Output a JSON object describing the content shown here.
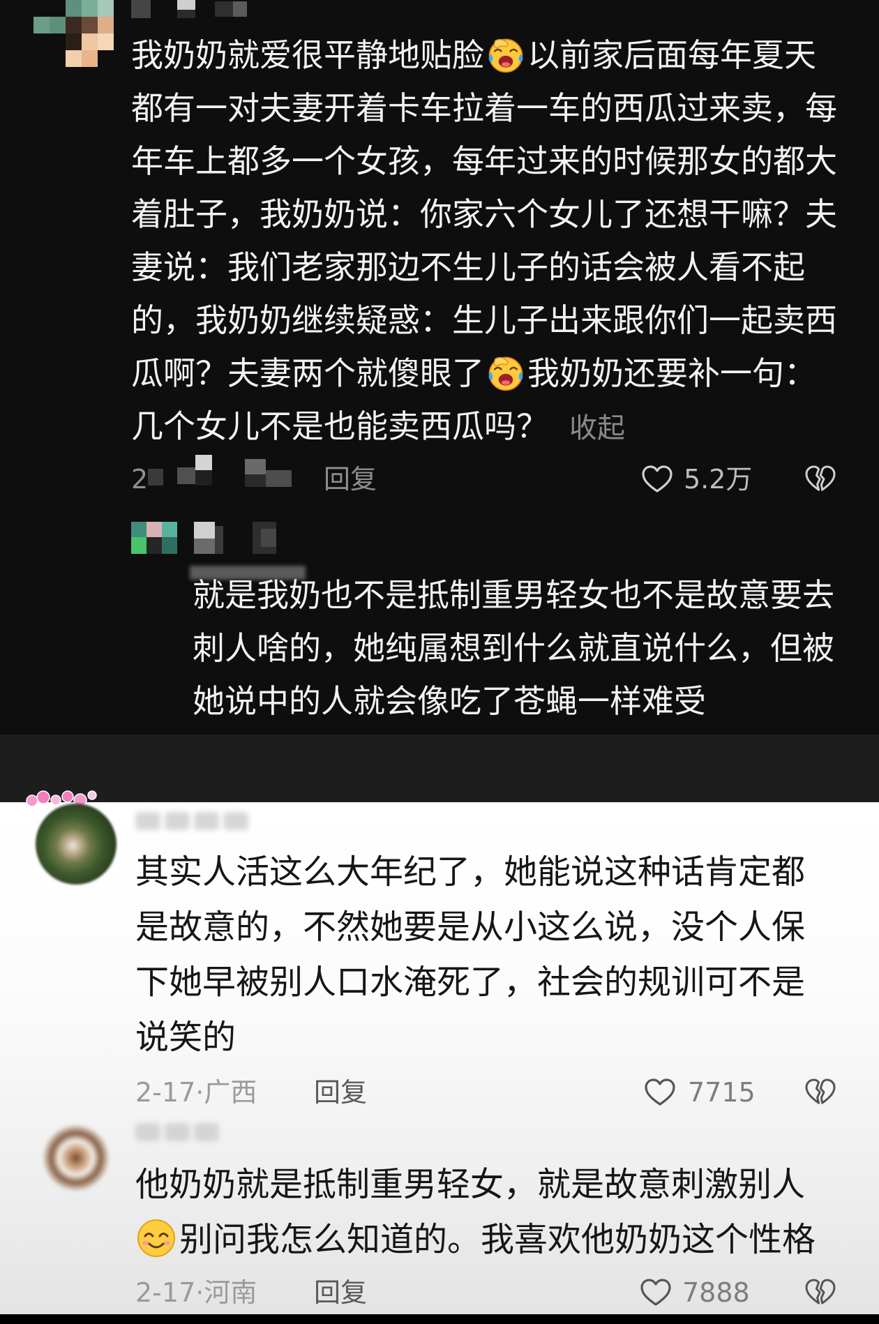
{
  "theme": {
    "dark_bg": "#0e0e0e",
    "dark_band": "#1d1d1d",
    "dark_text": "#f2f2f2",
    "light_text": "#161616",
    "meta_gray_dark": "#8f8f8f",
    "meta_gray_light": "#9a9a9a",
    "like_count_dark": "#bdbdbd"
  },
  "top_comment": {
    "avatar": "pixelated-avatar",
    "lines": [
      [
        "我奶奶就爱很平静地贴脸",
        {
          "emoji": "facepalm-laugh-emoji"
        },
        "以前家后面每年夏天"
      ],
      [
        "都有一对夫妻开着卡车拉着一车的西瓜过来卖，每"
      ],
      [
        "年车上都多一个女孩，每年过来的时候那女的都大"
      ],
      [
        "着肚子，我奶奶说：你家六个女儿了还想干嘛？夫"
      ],
      [
        "妻说：我们老家那边不生儿子的话会被人看不起"
      ],
      [
        "的，我奶奶继续疑惑：生儿子出来跟你们一起卖西"
      ],
      [
        "瓜啊？夫妻两个就傻眼了",
        {
          "emoji": "facepalm-laugh-emoji"
        },
        "我奶奶还要补一句："
      ],
      [
        "几个女儿不是也能卖西瓜吗？"
      ]
    ],
    "collapse_label": "收起",
    "time": "2",
    "reply_label": "回复",
    "like_icon": "heart-outline-icon",
    "like_count": "5.2万",
    "dislike_icon": "broken-heart-icon",
    "reply": {
      "avatar": "pixelated-avatar",
      "lines": [
        [
          "就是我奶也不是抵制重男轻女也不是故意要去"
        ],
        [
          "刺人啥的，她纯属想到什么就直说什么，但被"
        ],
        [
          "她说中的人就会像吃了苍蝇一样难受"
        ]
      ]
    }
  },
  "comments": [
    {
      "avatar": "blurred-avatar",
      "lines": [
        [
          "其实人活这么大年纪了，她能说这种话肯定都"
        ],
        [
          "是故意的，不然她要是从小这么说，没个人保"
        ],
        [
          "下她早被别人口水淹死了，社会的规训可不是"
        ],
        [
          "说笑的"
        ]
      ],
      "time_location": "2-17·广西",
      "reply_label": "回复",
      "like_icon": "heart-outline-icon",
      "like_count": "7715",
      "dislike_icon": "broken-heart-icon"
    },
    {
      "avatar": "blurred-avatar",
      "lines": [
        [
          "他奶奶就是抵制重男轻女，就是故意刺激别人"
        ],
        [
          {
            "emoji": "smile-emoji"
          },
          "别问我怎么知道的。我喜欢他奶奶这个性格"
        ]
      ],
      "time_location": "2-17·河南",
      "reply_label": "回复",
      "like_icon": "heart-outline-icon",
      "like_count": "7888",
      "dislike_icon": "broken-heart-icon"
    }
  ]
}
